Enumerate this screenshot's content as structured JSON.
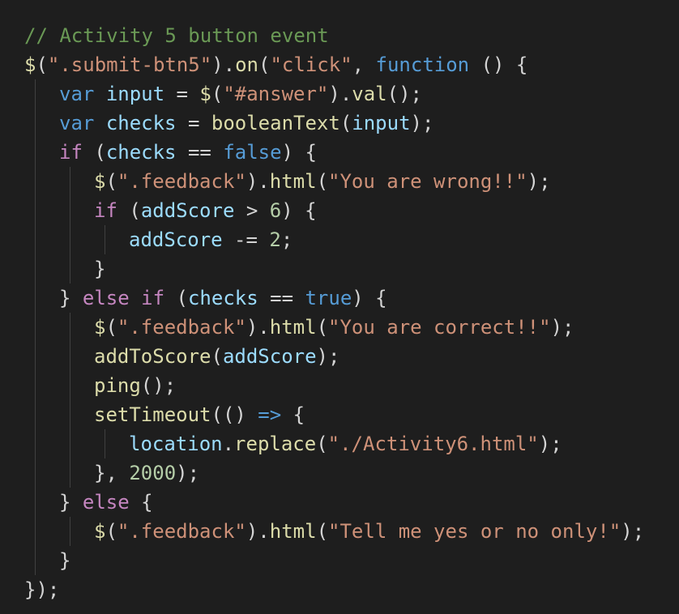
{
  "theme": {
    "background": "#1e1e1e",
    "guide": "#404040",
    "colors": {
      "comment": "#6a9955",
      "string": "#ce9178",
      "keyword": "#569cd6",
      "control": "#c586c0",
      "func": "#dcdcaa",
      "var": "#9cdcfe",
      "num": "#b5cea8",
      "plain": "#d4d4d4"
    }
  },
  "code": {
    "lines": [
      {
        "indent": 0,
        "tokens": [
          [
            "comment",
            "// Activity 5 button event"
          ]
        ]
      },
      {
        "indent": 0,
        "tokens": [
          [
            "func",
            "$"
          ],
          [
            "plain",
            "("
          ],
          [
            "string",
            "\".submit-btn5\""
          ],
          [
            "plain",
            ")."
          ],
          [
            "func",
            "on"
          ],
          [
            "plain",
            "("
          ],
          [
            "string",
            "\"click\""
          ],
          [
            "plain",
            ", "
          ],
          [
            "keyword",
            "function"
          ],
          [
            "plain",
            " () {"
          ]
        ]
      },
      {
        "indent": 1,
        "tokens": [
          [
            "keyword",
            "var"
          ],
          [
            "plain",
            " "
          ],
          [
            "var",
            "input"
          ],
          [
            "plain",
            " = "
          ],
          [
            "func",
            "$"
          ],
          [
            "plain",
            "("
          ],
          [
            "string",
            "\"#answer\""
          ],
          [
            "plain",
            ")."
          ],
          [
            "func",
            "val"
          ],
          [
            "plain",
            "();"
          ]
        ]
      },
      {
        "indent": 1,
        "tokens": [
          [
            "keyword",
            "var"
          ],
          [
            "plain",
            " "
          ],
          [
            "var",
            "checks"
          ],
          [
            "plain",
            " = "
          ],
          [
            "func",
            "booleanText"
          ],
          [
            "plain",
            "("
          ],
          [
            "var",
            "input"
          ],
          [
            "plain",
            ");"
          ]
        ]
      },
      {
        "indent": 1,
        "tokens": [
          [
            "control",
            "if"
          ],
          [
            "plain",
            " ("
          ],
          [
            "var",
            "checks"
          ],
          [
            "plain",
            " == "
          ],
          [
            "keyword",
            "false"
          ],
          [
            "plain",
            ") {"
          ]
        ]
      },
      {
        "indent": 2,
        "tokens": [
          [
            "func",
            "$"
          ],
          [
            "plain",
            "("
          ],
          [
            "string",
            "\".feedback\""
          ],
          [
            "plain",
            ")."
          ],
          [
            "func",
            "html"
          ],
          [
            "plain",
            "("
          ],
          [
            "string",
            "\"You are wrong!!\""
          ],
          [
            "plain",
            ");"
          ]
        ]
      },
      {
        "indent": 2,
        "tokens": [
          [
            "control",
            "if"
          ],
          [
            "plain",
            " ("
          ],
          [
            "var",
            "addScore"
          ],
          [
            "plain",
            " > "
          ],
          [
            "num",
            "6"
          ],
          [
            "plain",
            ") {"
          ]
        ]
      },
      {
        "indent": 3,
        "tokens": [
          [
            "var",
            "addScore"
          ],
          [
            "plain",
            " -= "
          ],
          [
            "num",
            "2"
          ],
          [
            "plain",
            ";"
          ]
        ]
      },
      {
        "indent": 2,
        "tokens": [
          [
            "plain",
            "}"
          ]
        ]
      },
      {
        "indent": 1,
        "tokens": [
          [
            "plain",
            "} "
          ],
          [
            "control",
            "else"
          ],
          [
            "plain",
            " "
          ],
          [
            "control",
            "if"
          ],
          [
            "plain",
            " ("
          ],
          [
            "var",
            "checks"
          ],
          [
            "plain",
            " == "
          ],
          [
            "keyword",
            "true"
          ],
          [
            "plain",
            ") {"
          ]
        ]
      },
      {
        "indent": 2,
        "tokens": [
          [
            "func",
            "$"
          ],
          [
            "plain",
            "("
          ],
          [
            "string",
            "\".feedback\""
          ],
          [
            "plain",
            ")."
          ],
          [
            "func",
            "html"
          ],
          [
            "plain",
            "("
          ],
          [
            "string",
            "\"You are correct!!\""
          ],
          [
            "plain",
            ");"
          ]
        ]
      },
      {
        "indent": 2,
        "tokens": [
          [
            "func",
            "addToScore"
          ],
          [
            "plain",
            "("
          ],
          [
            "var",
            "addScore"
          ],
          [
            "plain",
            ");"
          ]
        ]
      },
      {
        "indent": 2,
        "tokens": [
          [
            "func",
            "ping"
          ],
          [
            "plain",
            "();"
          ]
        ]
      },
      {
        "indent": 2,
        "tokens": [
          [
            "func",
            "setTimeout"
          ],
          [
            "plain",
            "(() "
          ],
          [
            "keyword",
            "=>"
          ],
          [
            "plain",
            " {"
          ]
        ]
      },
      {
        "indent": 3,
        "tokens": [
          [
            "var",
            "location"
          ],
          [
            "plain",
            "."
          ],
          [
            "func",
            "replace"
          ],
          [
            "plain",
            "("
          ],
          [
            "string",
            "\"./Activity6.html\""
          ],
          [
            "plain",
            ");"
          ]
        ]
      },
      {
        "indent": 2,
        "tokens": [
          [
            "plain",
            "}, "
          ],
          [
            "num",
            "2000"
          ],
          [
            "plain",
            ");"
          ]
        ]
      },
      {
        "indent": 1,
        "tokens": [
          [
            "plain",
            "} "
          ],
          [
            "control",
            "else"
          ],
          [
            "plain",
            " {"
          ]
        ]
      },
      {
        "indent": 2,
        "tokens": [
          [
            "func",
            "$"
          ],
          [
            "plain",
            "("
          ],
          [
            "string",
            "\".feedback\""
          ],
          [
            "plain",
            ")."
          ],
          [
            "func",
            "html"
          ],
          [
            "plain",
            "("
          ],
          [
            "string",
            "\"Tell me yes or no only!\""
          ],
          [
            "plain",
            ");"
          ]
        ]
      },
      {
        "indent": 1,
        "tokens": [
          [
            "plain",
            "}"
          ]
        ]
      },
      {
        "indent": 0,
        "tokens": [
          [
            "plain",
            "});"
          ]
        ]
      }
    ]
  }
}
